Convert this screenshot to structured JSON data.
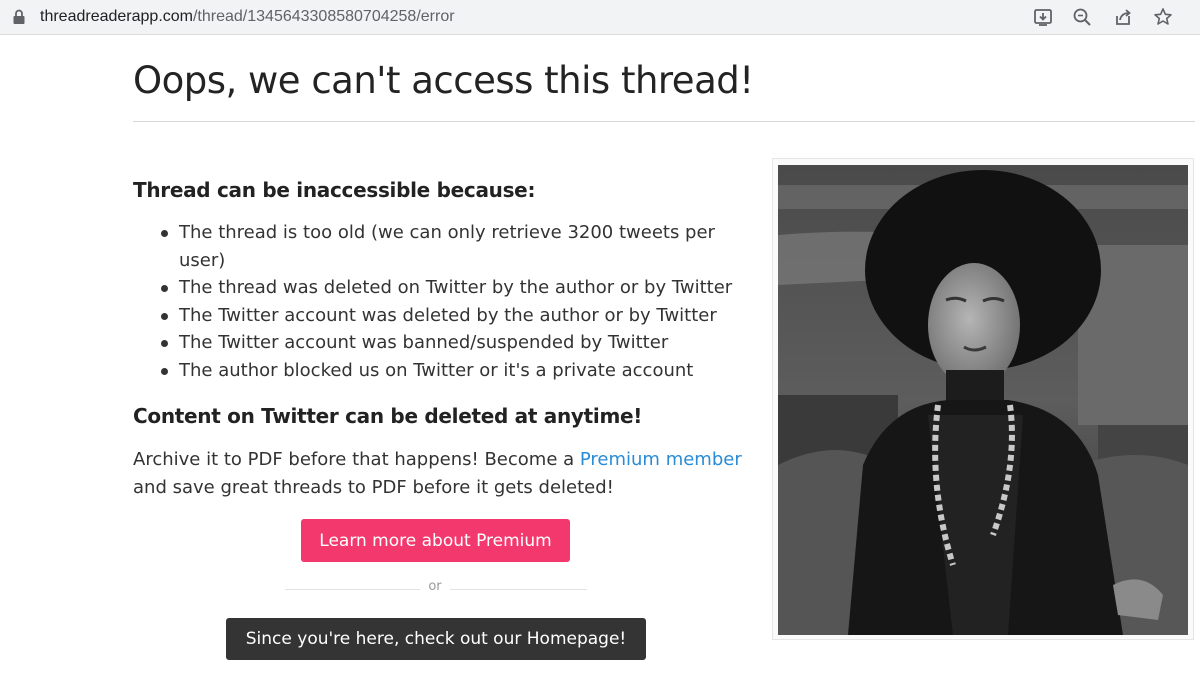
{
  "browser": {
    "url_host": "threadreaderapp.com",
    "url_path": "/thread/1345643308580704258/error",
    "icons": [
      "lock-icon",
      "install-app-icon",
      "zoom-icon",
      "share-icon",
      "bookmark-star-icon"
    ]
  },
  "page": {
    "title": "Oops, we can't access this thread!",
    "reasons_heading": "Thread can be inaccessible because:",
    "reasons": [
      "The thread is too old (we can only retrieve 3200 tweets per user)",
      "The thread was deleted on Twitter by the author or by Twitter",
      "The Twitter account was deleted by the author or by Twitter",
      "The Twitter account was banned/suspended by Twitter",
      "The author blocked us on Twitter or it's a private account"
    ],
    "deleted_heading": "Content on Twitter can be deleted at anytime!",
    "archive_text_before": "Archive it to PDF before that happens! Become a ",
    "premium_link": "Premium member",
    "archive_text_after": " and save great threads to PDF before it gets deleted!",
    "premium_button": "Learn more about Premium",
    "divider_text": "or",
    "homepage_button": "Since you're here, check out our Homepage!"
  },
  "colors": {
    "premium_button": "#f2386c",
    "homepage_button": "#343434",
    "link": "#2a8bd6",
    "url_bar": "#f1f3f4"
  }
}
